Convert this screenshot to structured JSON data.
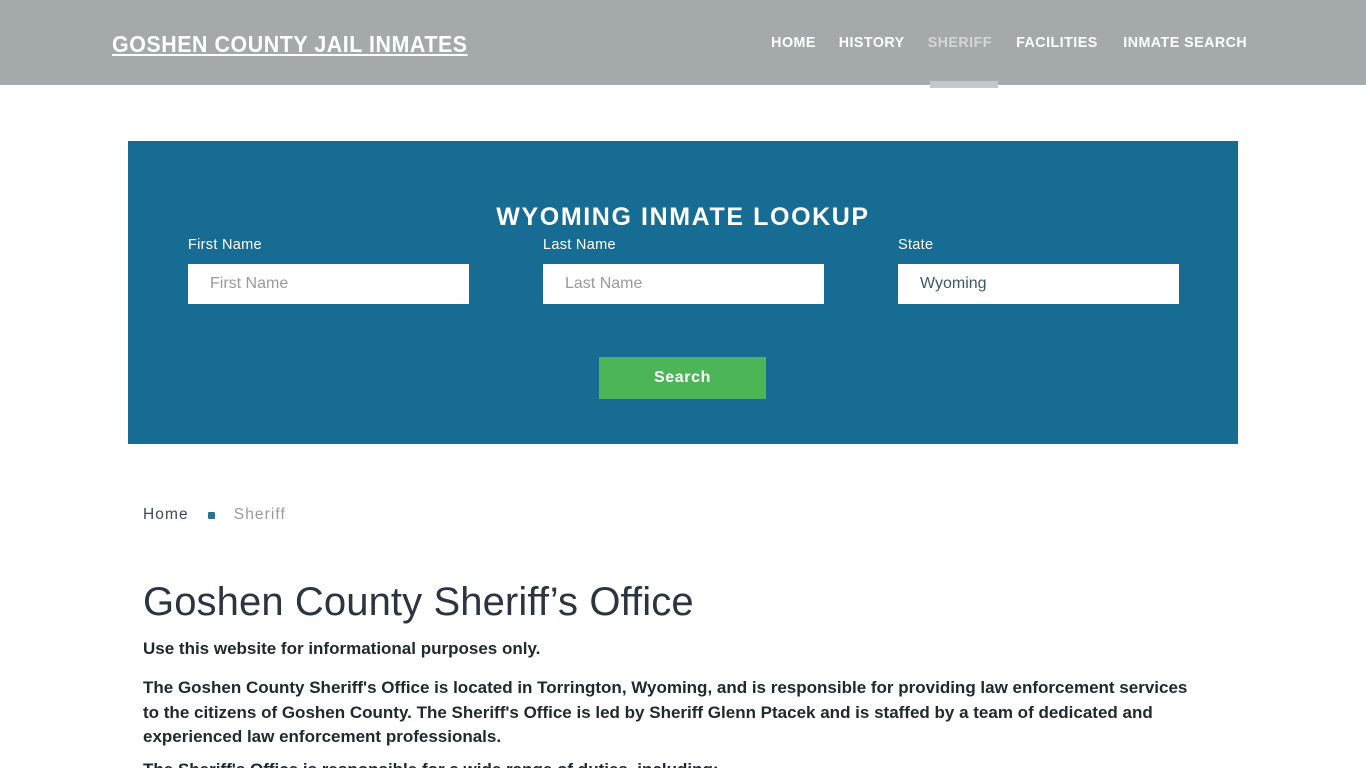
{
  "header": {
    "site_title": "GOSHEN COUNTY JAIL INMATES",
    "background_color": "#a4a9ac",
    "nav": [
      {
        "label": "HOME",
        "active": false
      },
      {
        "label": "HISTORY",
        "active": false
      },
      {
        "label": "SHERIFF",
        "active": true
      },
      {
        "label": "FACILITIES",
        "active": false
      },
      {
        "label": "INMATE SEARCH",
        "active": false
      }
    ]
  },
  "search_panel": {
    "heading": "WYOMING INMATE LOOKUP",
    "background_color": "#166c93",
    "fields": [
      {
        "label": "First Name",
        "placeholder": "First Name",
        "value": ""
      },
      {
        "label": "Last Name",
        "placeholder": "Last Name",
        "value": ""
      },
      {
        "label": "State",
        "placeholder": "State",
        "value": "Wyoming"
      }
    ],
    "submit_label": "Search",
    "submit_color": "#4cb558"
  },
  "breadcrumb": {
    "home_label": "Home",
    "separator": "•",
    "current_label": "Sheriff",
    "separator_color": "#2a7391"
  },
  "main": {
    "title": "Goshen County Sheriff’s Office",
    "lead_note": "Use this website for informational purposes only.",
    "paragraph": "The Goshen County Sheriff's Office is located in Torrington, Wyoming, and is responsible for providing law enforcement services to the citizens of Goshen County. The Sheriff's Office is led by Sheriff Glenn Ptacek and is staffed by a team of dedicated and experienced law enforcement professionals.",
    "paragraph_next_partial": "The Sheriff's Office is responsible for a wide range of duties, including:"
  }
}
